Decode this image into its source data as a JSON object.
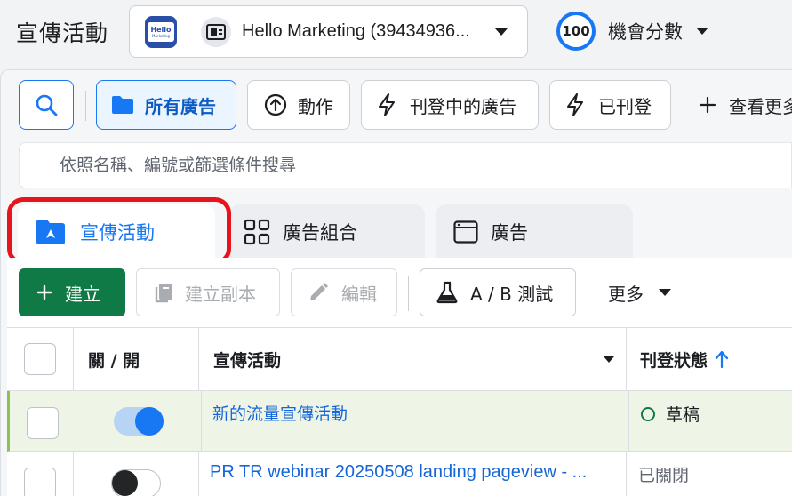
{
  "header": {
    "title": "宣傳活動",
    "account_logo_line1": "Hello",
    "account_logo_line2": "Marketing",
    "account_name": "Hello Marketing (39434936...",
    "score": "100",
    "score_label": "機會分數"
  },
  "filters": {
    "all_ads": "所有廣告",
    "action": "動作",
    "active_ads": "刊登中的廣告",
    "published": "已刊登",
    "view_more": "查看更多"
  },
  "search": {
    "placeholder": "依照名稱、編號或篩選條件搜尋"
  },
  "tabs": [
    {
      "label": "宣傳活動",
      "selected": true
    },
    {
      "label": "廣告組合",
      "selected": false
    },
    {
      "label": "廣告",
      "selected": false
    }
  ],
  "toolbar": {
    "create": "建立",
    "duplicate": "建立副本",
    "edit": "編輯",
    "ab_test": "A / B 測試",
    "more": "更多"
  },
  "table": {
    "columns": {
      "toggle": "關 / 開",
      "name": "宣傳活動",
      "status": "刊登狀態"
    },
    "rows": [
      {
        "enabled": true,
        "name": "新的流量宣傳活動",
        "status": "草稿"
      },
      {
        "enabled": false,
        "name": "PR TR webinar 20250508 landing pageview - ...",
        "status": "已關閉"
      }
    ]
  },
  "colors": {
    "accent": "#1877f2",
    "create_button": "#0f7a45",
    "highlight": "#e8141c",
    "draft_dot": "#0f7a45"
  }
}
